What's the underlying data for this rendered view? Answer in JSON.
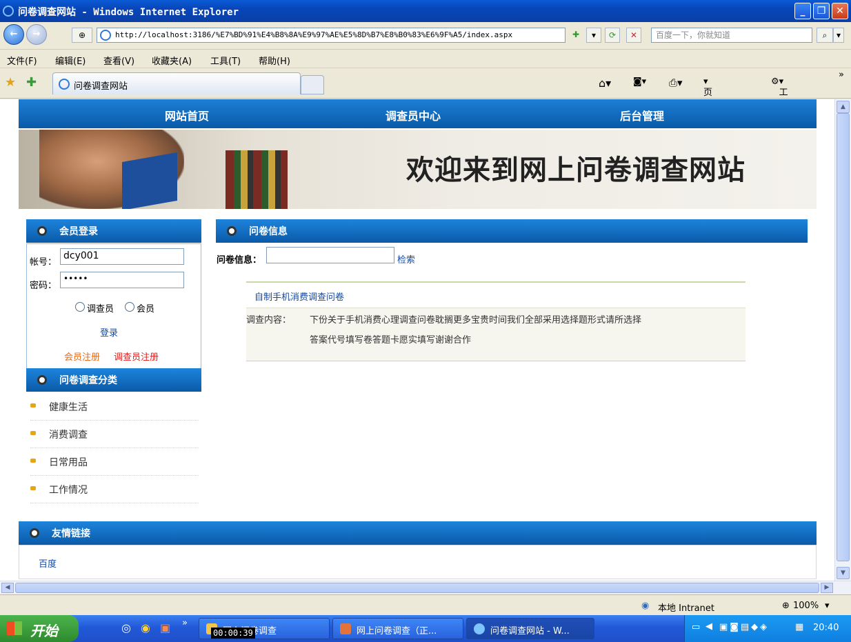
{
  "window": {
    "title": "问卷调查网站 - Windows Internet Explorer"
  },
  "address_bar": {
    "url": "http://localhost:3186/%E7%BD%91%E4%B8%8A%E9%97%AE%E5%8D%B7%E8%B0%83%E6%9F%A5/index.aspx",
    "search_placeholder": "百度一下，你就知道"
  },
  "menu": [
    "文件(F)",
    "编辑(E)",
    "查看(V)",
    "收藏夹(A)",
    "工具(T)",
    "帮助(H)"
  ],
  "tab": {
    "title": "问卷调查网站"
  },
  "commandbar": {
    "page": "页面(P)",
    "tools": "工具(O)"
  },
  "site": {
    "nav": [
      "网站首页",
      "调查员中心",
      "后台管理"
    ],
    "welcome": "欢迎来到网上问卷调查网站",
    "login": {
      "heading": "会员登录",
      "account_label": "帐号：",
      "account_value": "dcy001",
      "password_label": "密码：",
      "password_mask": "•••••",
      "role1": "调查员",
      "role2": "会员",
      "login_button": "登录",
      "register_member": "会员注册",
      "register_surveyor": "调查员注册"
    },
    "categories": {
      "heading": "问卷调查分类",
      "items": [
        "健康生活",
        "消费调查",
        "日常用品",
        "工作情况"
      ]
    },
    "survey_info": {
      "heading": "问卷信息",
      "search_label": "问卷信息：",
      "search_value": "",
      "search_button": "检索",
      "item_title": "自制手机消费调查问卷",
      "content_label": "调查内容：",
      "content_line1": "下份关于手机消费心理调查问卷耽搁更多宝贵时间我们全部采用选择题形式请所选择",
      "content_line2": "答案代号填写卷答题卡愿实填写谢谢合作"
    },
    "friends": {
      "heading": "友情链接",
      "links": [
        "百度"
      ]
    }
  },
  "status": {
    "zone": "本地 Intranet",
    "zoom": "100%"
  },
  "taskbar": {
    "start": "开始",
    "items": [
      "网上问卷调查",
      "网上问卷调查（正...",
      "问卷调查网站 - W..."
    ],
    "timer": "00:00:39",
    "clock": "20:40"
  },
  "colors": {
    "nav_blue": "#0a5aa8",
    "link_blue": "#15489f",
    "link_red": "#e02020",
    "link_orange": "#e76a1a"
  }
}
